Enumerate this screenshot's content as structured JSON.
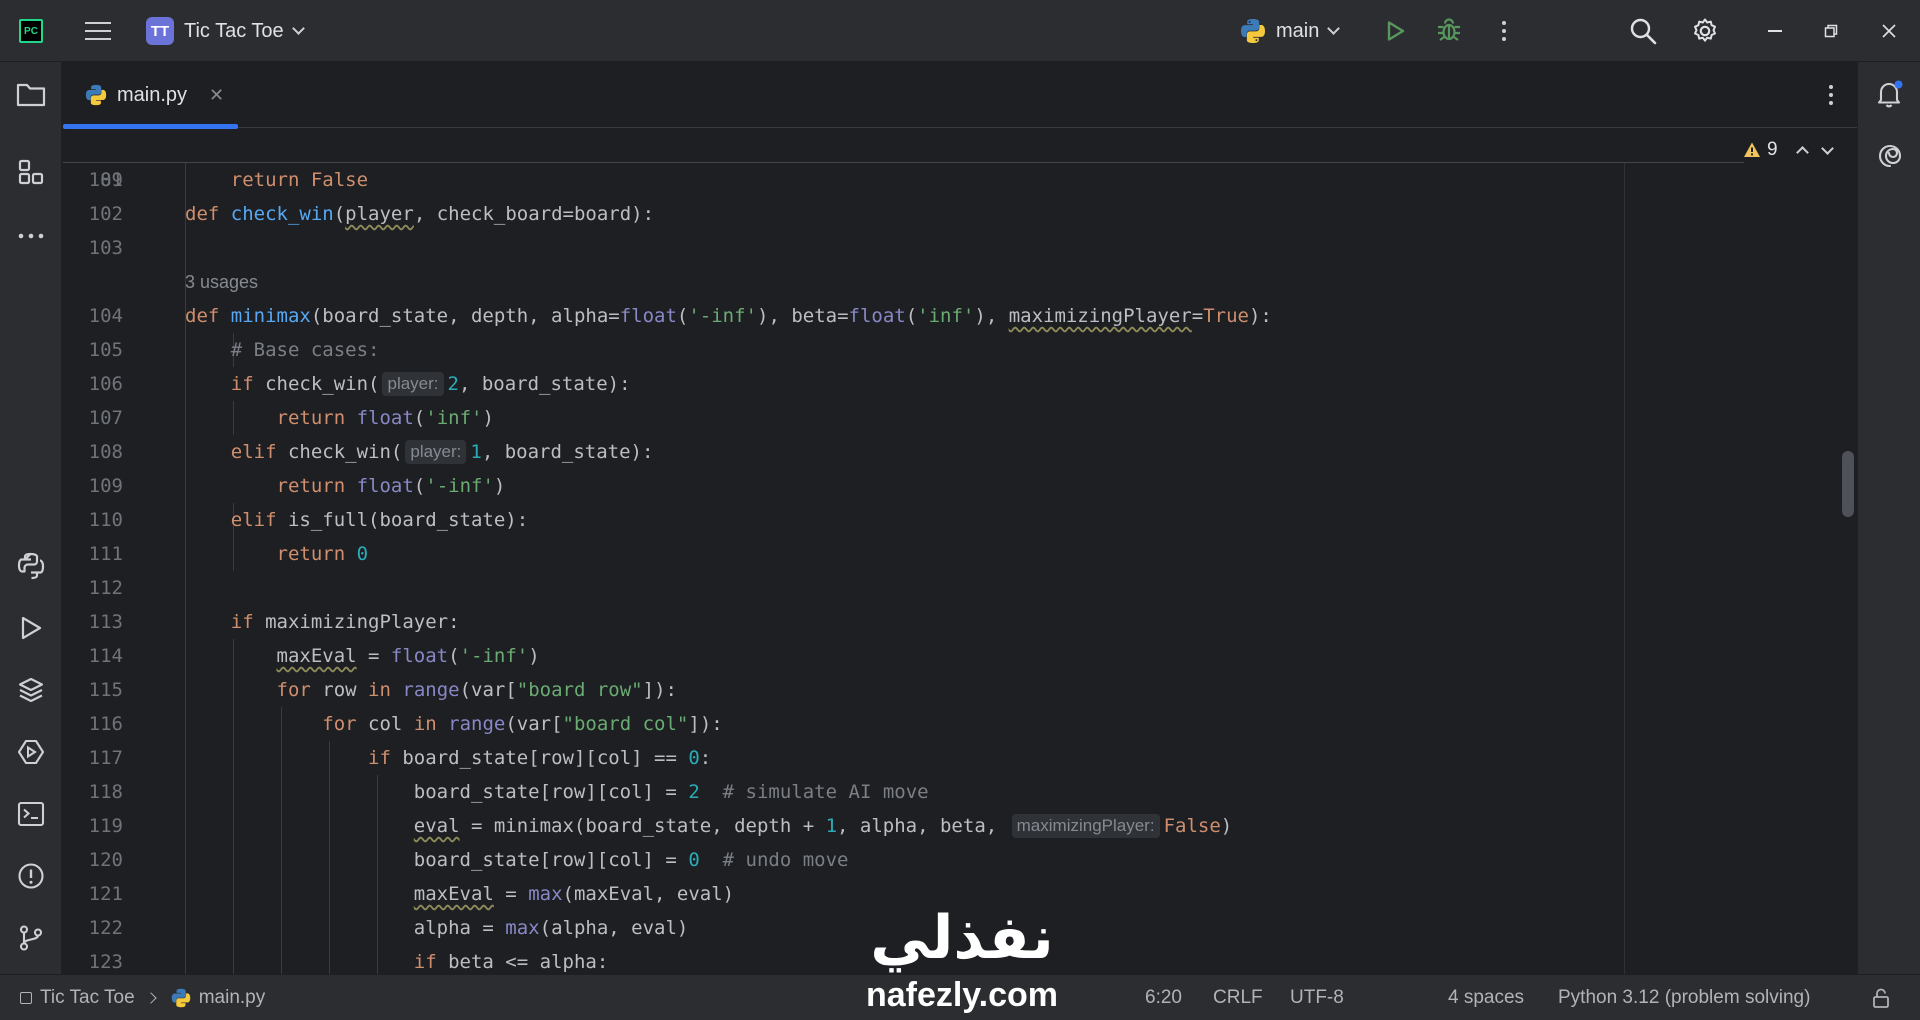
{
  "titlebar": {
    "app_logo_text": "PC",
    "project_badge": "TT",
    "project_name": "Tic Tac Toe",
    "run_config": "main"
  },
  "tabs": [
    {
      "label": "main.py",
      "icon": "python-icon",
      "active": true
    }
  ],
  "editor": {
    "inspection_count": "9",
    "sticky_line_number": "89",
    "lines": [
      {
        "n": "101"
      },
      {
        "n": "102"
      },
      {
        "n": "103"
      },
      {
        "usages": "3 usages"
      },
      {
        "n": "104"
      },
      {
        "n": "105"
      },
      {
        "n": "106"
      },
      {
        "n": "107"
      },
      {
        "n": "108"
      },
      {
        "n": "109"
      },
      {
        "n": "110"
      },
      {
        "n": "111"
      },
      {
        "n": "112"
      },
      {
        "n": "113"
      },
      {
        "n": "114"
      },
      {
        "n": "115"
      },
      {
        "n": "116"
      },
      {
        "n": "117"
      },
      {
        "n": "118"
      },
      {
        "n": "119"
      },
      {
        "n": "120"
      },
      {
        "n": "121"
      },
      {
        "n": "122"
      },
      {
        "n": "123"
      }
    ],
    "code": {
      "sticky": [
        [
          "kw",
          "def "
        ],
        [
          "fn",
          "check_win"
        ],
        [
          "",
          "("
        ],
        [
          "wv",
          "player"
        ],
        [
          "",
          ", check_board=board):"
        ]
      ],
      "l101": [
        [
          "",
          "    "
        ],
        [
          "kw",
          "return "
        ],
        [
          "kw",
          "False"
        ]
      ],
      "l104": [
        [
          "kw",
          "def "
        ],
        [
          "fn",
          "minimax"
        ],
        [
          "",
          "(board_state, depth, alpha="
        ],
        [
          "bi",
          "float"
        ],
        [
          "",
          "("
        ],
        [
          "st",
          "'-inf'"
        ],
        [
          "",
          "), beta="
        ],
        [
          "bi",
          "float"
        ],
        [
          "",
          "("
        ],
        [
          "st",
          "'inf'"
        ],
        [
          "",
          "), "
        ],
        [
          "wv",
          "maximizingPlayer"
        ],
        [
          "",
          "="
        ],
        [
          "kw",
          "True"
        ],
        [
          "",
          "):"
        ]
      ],
      "l105": [
        [
          "",
          "    "
        ],
        [
          "cm",
          "# Base cases:"
        ]
      ],
      "l106a": [
        [
          "",
          "    "
        ],
        [
          "kw",
          "if "
        ],
        [
          "",
          "check_win("
        ]
      ],
      "l106h": "player:",
      "l106b": [
        [
          "nu",
          "2"
        ],
        [
          "",
          ", board_state):"
        ]
      ],
      "l107": [
        [
          "",
          "        "
        ],
        [
          "kw",
          "return "
        ],
        [
          "bi",
          "float"
        ],
        [
          "",
          "("
        ],
        [
          "st",
          "'inf'"
        ],
        [
          "",
          ")"
        ]
      ],
      "l108a": [
        [
          "",
          "    "
        ],
        [
          "kw",
          "elif "
        ],
        [
          "",
          "check_win("
        ]
      ],
      "l108h": "player:",
      "l108b": [
        [
          "nu",
          "1"
        ],
        [
          "",
          ", board_state):"
        ]
      ],
      "l109": [
        [
          "",
          "        "
        ],
        [
          "kw",
          "return "
        ],
        [
          "bi",
          "float"
        ],
        [
          "",
          "("
        ],
        [
          "st",
          "'-inf'"
        ],
        [
          "",
          ")"
        ]
      ],
      "l110": [
        [
          "",
          "    "
        ],
        [
          "kw",
          "elif "
        ],
        [
          "",
          "is_full(board_state):"
        ]
      ],
      "l111": [
        [
          "",
          "        "
        ],
        [
          "kw",
          "return "
        ],
        [
          "nu",
          "0"
        ]
      ],
      "l113": [
        [
          "",
          "    "
        ],
        [
          "kw",
          "if "
        ],
        [
          "",
          "maximizingPlayer:"
        ]
      ],
      "l114": [
        [
          "",
          "        "
        ],
        [
          "wv",
          "maxEval"
        ],
        [
          "",
          " = "
        ],
        [
          "bi",
          "float"
        ],
        [
          "",
          "("
        ],
        [
          "st",
          "'-inf'"
        ],
        [
          "",
          ")"
        ]
      ],
      "l115": [
        [
          "",
          "        "
        ],
        [
          "kw",
          "for "
        ],
        [
          "",
          "row "
        ],
        [
          "kw",
          "in "
        ],
        [
          "bi",
          "range"
        ],
        [
          "",
          "(var["
        ],
        [
          "st",
          "\"board row\""
        ],
        [
          "",
          "]):"
        ]
      ],
      "l116": [
        [
          "",
          "            "
        ],
        [
          "kw",
          "for "
        ],
        [
          "",
          "col "
        ],
        [
          "kw",
          "in "
        ],
        [
          "bi",
          "range"
        ],
        [
          "",
          "(var["
        ],
        [
          "st",
          "\"board col\""
        ],
        [
          "",
          "]):"
        ]
      ],
      "l117": [
        [
          "",
          "                "
        ],
        [
          "kw",
          "if "
        ],
        [
          "",
          "board_state[row][col] == "
        ],
        [
          "nu",
          "0"
        ],
        [
          "",
          ":"
        ]
      ],
      "l118": [
        [
          "",
          "                    board_state[row][col] = "
        ],
        [
          "nu",
          "2"
        ],
        [
          "",
          "  "
        ],
        [
          "cm",
          "# simulate AI move"
        ]
      ],
      "l119a": [
        [
          "",
          "                    "
        ],
        [
          "wv",
          "eval"
        ],
        [
          "",
          " = minimax(board_state, depth + "
        ],
        [
          "nu",
          "1"
        ],
        [
          "",
          ", alpha, beta, "
        ]
      ],
      "l119h": "maximizingPlayer:",
      "l119b": [
        [
          "kw",
          "False"
        ],
        [
          "",
          ")"
        ]
      ],
      "l120": [
        [
          "",
          "                    board_state[row][col] = "
        ],
        [
          "nu",
          "0"
        ],
        [
          "",
          "  "
        ],
        [
          "cm",
          "# undo move"
        ]
      ],
      "l121": [
        [
          "",
          "                    "
        ],
        [
          "wv",
          "maxEval"
        ],
        [
          "",
          " = "
        ],
        [
          "bi",
          "max"
        ],
        [
          "",
          "(maxEval, eval)"
        ]
      ],
      "l122": [
        [
          "",
          "                    alpha = "
        ],
        [
          "bi",
          "max"
        ],
        [
          "",
          "(alpha, eval)"
        ]
      ],
      "l123": [
        [
          "",
          "                    "
        ],
        [
          "kw",
          "if "
        ],
        [
          "",
          "beta <= alpha:"
        ]
      ]
    }
  },
  "statusbar": {
    "breadcrumb_project": "Tic Tac Toe",
    "breadcrumb_file": "main.py",
    "caret": "6:20",
    "line_sep": "CRLF",
    "encoding": "UTF-8",
    "indent": "4 spaces",
    "interpreter": "Python 3.12 (problem solving)"
  },
  "watermark": {
    "arabic": "نفذلي",
    "latin": "nafezly.com"
  },
  "colors": {
    "accent": "#3574f0",
    "run_green": "#57965c",
    "warning": "#f2c55c",
    "project_badge": "#6b73d9"
  }
}
